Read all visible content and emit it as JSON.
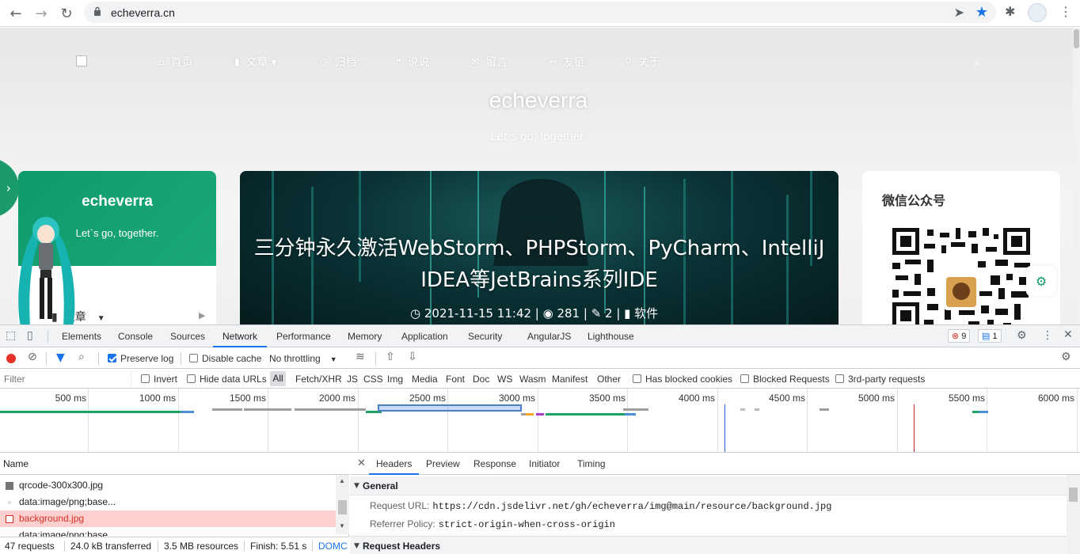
{
  "browser": {
    "url": "echeverra.cn"
  },
  "site": {
    "nav": [
      {
        "icon": "home-icon",
        "glyph": "⌂",
        "label": "首页"
      },
      {
        "icon": "bookmark-icon",
        "glyph": "▮",
        "label": "文章 ▾"
      },
      {
        "icon": "clock-icon",
        "glyph": "◷",
        "label": "归档"
      },
      {
        "icon": "quote-icon",
        "glyph": "❝",
        "label": "说说"
      },
      {
        "icon": "comments-icon",
        "glyph": "✉",
        "label": "留言"
      },
      {
        "icon": "link-icon",
        "glyph": "⚯",
        "label": "友链"
      },
      {
        "icon": "user-icon",
        "glyph": "⚲",
        "label": "关于"
      }
    ],
    "title": "echeverra",
    "subtitle": "Let`s go, together.",
    "profile": {
      "name": "echeverra",
      "motto": "Let`s go, together.",
      "menu_label": "文章"
    },
    "banner": {
      "title_line1": "三分钟永久激活WebStorm、PHPStorm、PyCharm、IntelliJ",
      "title_line2": "IDEA等JetBrains系列IDE",
      "meta": "◷ 2021-11-15 11:42  |  ◉ 281  |  ✎ 2  |  ▮ 软件"
    },
    "wechat_title": "微信公众号"
  },
  "devtools": {
    "tabs": [
      "Elements",
      "Console",
      "Sources",
      "Network",
      "Performance",
      "Memory",
      "Application",
      "Security",
      "AngularJS",
      "Lighthouse"
    ],
    "active_tab": "Network",
    "errors": "9",
    "messages": "1",
    "toolbar": {
      "preserve_log": "Preserve log",
      "disable_cache": "Disable cache",
      "throttling": "No throttling"
    },
    "filter": {
      "placeholder": "Filter",
      "invert": "Invert",
      "hide_data_urls": "Hide data URLs",
      "types": [
        "All",
        "Fetch/XHR",
        "JS",
        "CSS",
        "Img",
        "Media",
        "Font",
        "Doc",
        "WS",
        "Wasm",
        "Manifest",
        "Other"
      ],
      "has_blocked_cookies": "Has blocked cookies",
      "blocked_requests": "Blocked Requests",
      "third_party": "3rd-party requests"
    },
    "timeline_ticks": [
      "500 ms",
      "1000 ms",
      "1500 ms",
      "2000 ms",
      "2500 ms",
      "3000 ms",
      "3500 ms",
      "4000 ms",
      "4500 ms",
      "5000 ms",
      "5500 ms",
      "6000 ms"
    ],
    "requests_header": "Name",
    "requests": [
      {
        "name": "qrcode-300x300.jpg",
        "error": false
      },
      {
        "name": "data:image/png;base...",
        "error": false
      },
      {
        "name": "background.jpg",
        "error": true
      },
      {
        "name": "data:image/png;base...",
        "error": false
      }
    ],
    "status": {
      "requests": "47 requests",
      "transferred": "24.0 kB transferred",
      "resources": "3.5 MB resources",
      "finish": "Finish: 5.51 s",
      "domc": "DOMC"
    },
    "detail_tabs": [
      "Headers",
      "Preview",
      "Response",
      "Initiator",
      "Timing"
    ],
    "general": {
      "title": "General",
      "request_url_key": "Request URL:",
      "request_url": "https://cdn.jsdelivr.net/gh/echeverra/img@main/resource/background.jpg",
      "referrer_key": "Referrer Policy:",
      "referrer": "strict-origin-when-cross-origin"
    },
    "request_headers_title": "Request Headers"
  },
  "colors": {
    "accent": "#1a73e8",
    "brand_green": "#1b9b6b",
    "error_red": "#d93025"
  }
}
